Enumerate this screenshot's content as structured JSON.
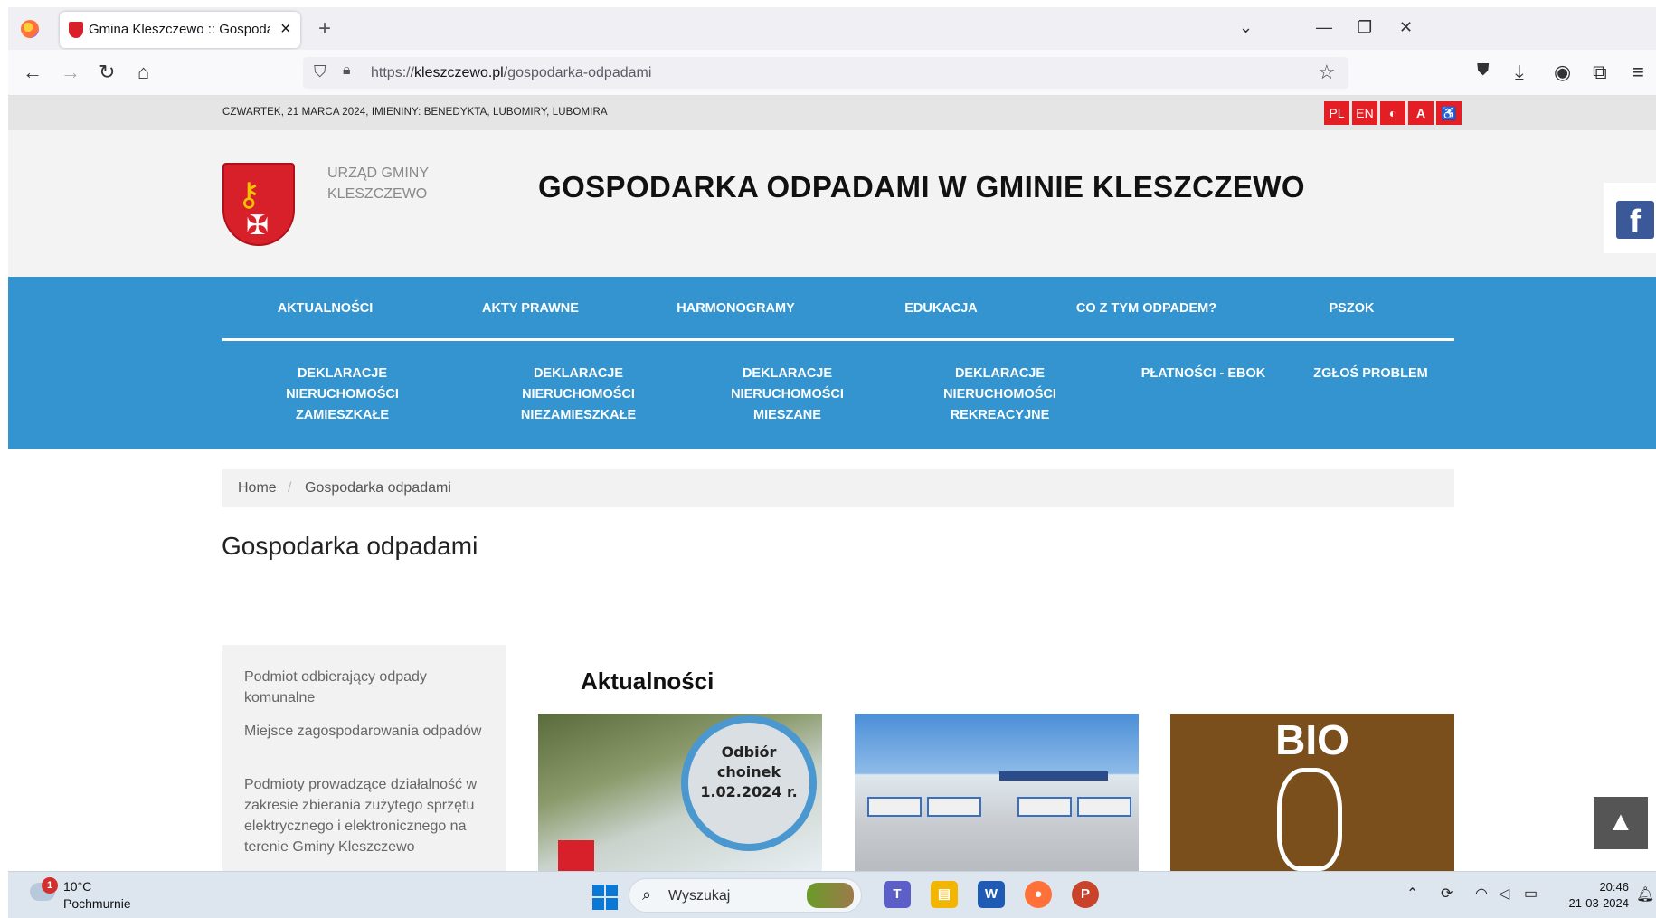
{
  "browser": {
    "tab_title": "Gmina Kleszczewo :: Gospodarka odpadami",
    "url_host": "kleszczewo.pl",
    "url_prefix": "https://",
    "url_path": "/gospodarka-odpadami"
  },
  "topstrip": {
    "date_text": "CZWARTEK, 21 MARCA 2024, IMIENINY: BENEDYKTA, LUBOMIRY, LUBOMIRA",
    "lang_pl": "PL",
    "lang_en": "EN",
    "contrast": "◐",
    "font_size": "A",
    "accessibility": "♿"
  },
  "header": {
    "office_name": "URZĄD GMINY KLESZCZEWO",
    "site_title": "GOSPODARKA ODPADAMI W GMINIE KLESZCZEWO",
    "facebook": "f"
  },
  "nav": {
    "row1": [
      "AKTUALNOŚCI",
      "AKTY PRAWNE",
      "HARMONOGRAMY",
      "EDUKACJA",
      "CO Z TYM ODPADEM?",
      "PSZOK"
    ],
    "row2": [
      "DEKLARACJE NIERUCHOMOŚCI ZAMIESZKAŁE",
      "DEKLARACJE NIERUCHOMOŚCI NIEZAMIESZKAŁE",
      "DEKLARACJE NIERUCHOMOŚCI MIESZANE",
      "DEKLARACJE NIERUCHOMOŚCI REKREACYJNE",
      "PŁATNOŚCI - EBOK",
      "ZGŁOŚ PROBLEM"
    ]
  },
  "breadcrumb": {
    "home": "Home",
    "separator": "/",
    "current": "Gospodarka odpadami"
  },
  "page_title": "Gospodarka odpadami",
  "sidebar": {
    "links": [
      "Podmiot odbierający odpady komunalne",
      "Miejsce zagospodarowania odpadów",
      "Podmioty prowadzące działalność w zakresie zbierania zużytego sprzętu elektrycznego i elektronicznego na terenie Gminy Kleszczewo"
    ]
  },
  "news": {
    "heading": "Aktualności",
    "card1_badge": "Odbiór choinek 1.02.2024 r.",
    "card3_label": "BIO"
  },
  "taskbar": {
    "weather_badge": "1",
    "temperature": "10°C",
    "condition": "Pochmurnie",
    "search_placeholder": "Wyszukaj",
    "time": "20:46",
    "date": "21-03-2024"
  },
  "colors": {
    "nav_blue": "#3394cf",
    "accent_red": "#e31e24"
  }
}
